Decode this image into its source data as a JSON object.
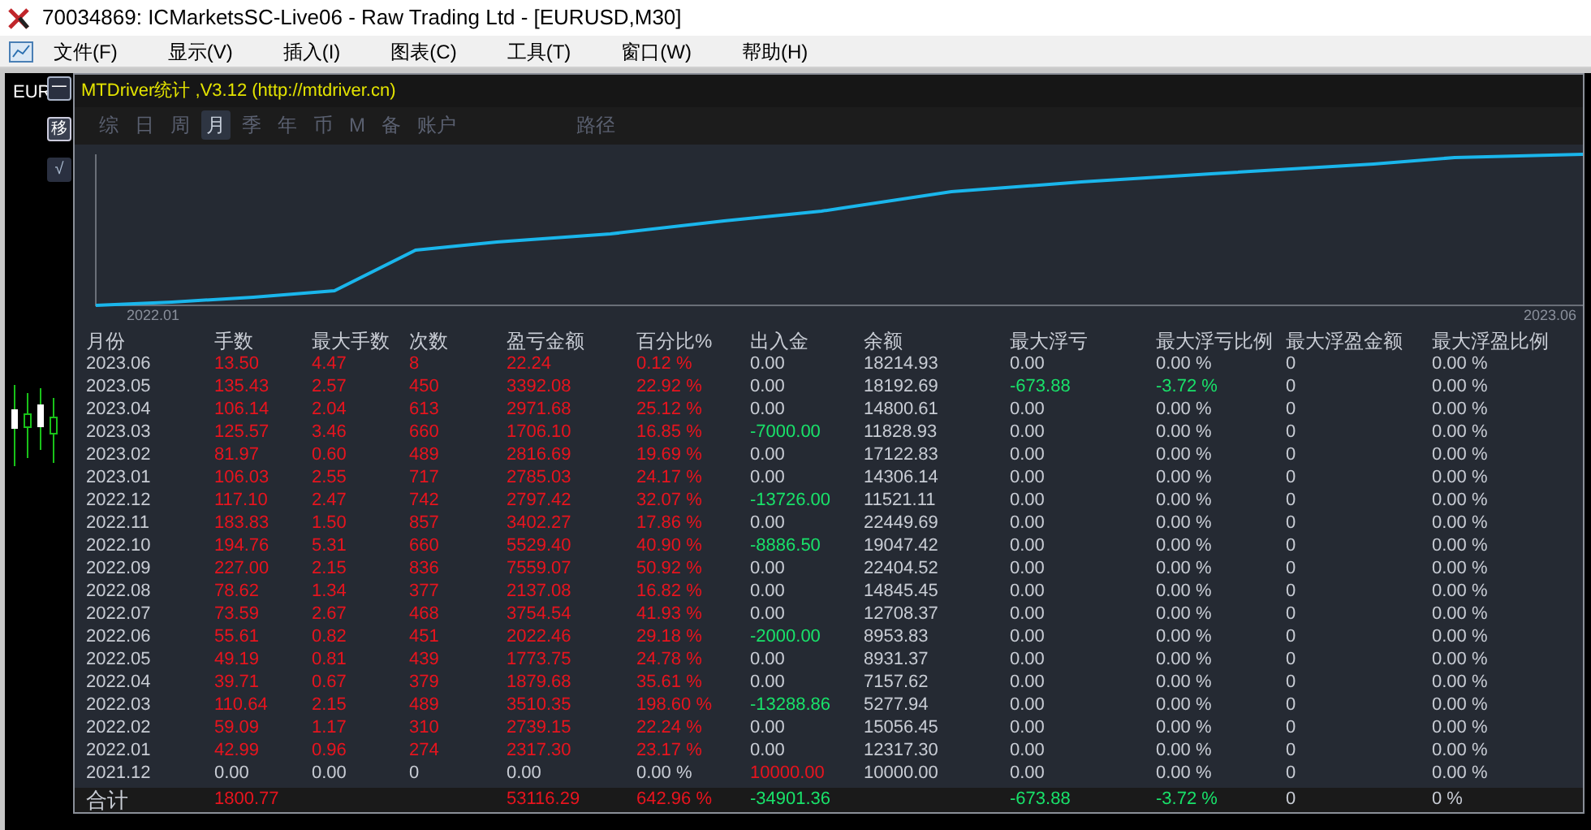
{
  "window": {
    "title": "70034869: ICMarketsSC-Live06 - Raw Trading Ltd - [EURUSD,M30]"
  },
  "menu": [
    "文件(F)",
    "显示(V)",
    "插入(I)",
    "图表(C)",
    "工具(T)",
    "窗口(W)",
    "帮助(H)"
  ],
  "side": {
    "symbol": "EUR",
    "buttons": [
      "一",
      "移",
      "√"
    ]
  },
  "panel": {
    "title": "MTDriver统计 ,V3.12 (http://mtdriver.cn)",
    "tabs": [
      {
        "label": "综",
        "selected": false
      },
      {
        "label": "日",
        "selected": false
      },
      {
        "label": "周",
        "selected": false
      },
      {
        "label": "月",
        "selected": true
      },
      {
        "label": "季",
        "selected": false
      },
      {
        "label": "年",
        "selected": false
      },
      {
        "label": "币",
        "selected": false
      },
      {
        "label": "M",
        "selected": false
      },
      {
        "label": "备",
        "selected": false
      },
      {
        "label": "账户",
        "selected": false
      }
    ],
    "path_button": "路径",
    "chart": {
      "x_start": "2022.01",
      "x_end": "2023.06"
    },
    "table": {
      "columns": [
        "月份",
        "手数",
        "最大手数",
        "次数",
        "盈亏金额",
        "百分比%",
        "出入金",
        "余额",
        "最大浮亏",
        "最大浮亏比例",
        "最大浮盈金额",
        "最大浮盈比例"
      ],
      "rows": [
        [
          {
            "text": "2023.06",
            "color": "#c8ccd4"
          },
          {
            "text": "13.50",
            "color": "#e8141e"
          },
          {
            "text": "4.47",
            "color": "#e8141e"
          },
          {
            "text": "8",
            "color": "#e8141e"
          },
          {
            "text": "22.24",
            "color": "#e8141e"
          },
          {
            "text": "0.12 %",
            "color": "#e8141e"
          },
          {
            "text": "0.00",
            "color": "#c8ccd4"
          },
          {
            "text": "18214.93",
            "color": "#c8ccd4"
          },
          {
            "text": "0.00",
            "color": "#c8ccd4"
          },
          {
            "text": "0.00 %",
            "color": "#c8ccd4"
          },
          {
            "text": "0",
            "color": "#c8ccd4"
          },
          {
            "text": "0.00 %",
            "color": "#c8ccd4"
          }
        ],
        [
          {
            "text": "2023.05",
            "color": "#c8ccd4"
          },
          {
            "text": "135.43",
            "color": "#e8141e"
          },
          {
            "text": "2.57",
            "color": "#e8141e"
          },
          {
            "text": "450",
            "color": "#e8141e"
          },
          {
            "text": "3392.08",
            "color": "#e8141e"
          },
          {
            "text": "22.92 %",
            "color": "#e8141e"
          },
          {
            "text": "0.00",
            "color": "#c8ccd4"
          },
          {
            "text": "18192.69",
            "color": "#c8ccd4"
          },
          {
            "text": "-673.88",
            "color": "#19e26a"
          },
          {
            "text": "-3.72 %",
            "color": "#19e26a"
          },
          {
            "text": "0",
            "color": "#c8ccd4"
          },
          {
            "text": "0.00 %",
            "color": "#c8ccd4"
          }
        ],
        [
          {
            "text": "2023.04",
            "color": "#c8ccd4"
          },
          {
            "text": "106.14",
            "color": "#e8141e"
          },
          {
            "text": "2.04",
            "color": "#e8141e"
          },
          {
            "text": "613",
            "color": "#e8141e"
          },
          {
            "text": "2971.68",
            "color": "#e8141e"
          },
          {
            "text": "25.12 %",
            "color": "#e8141e"
          },
          {
            "text": "0.00",
            "color": "#c8ccd4"
          },
          {
            "text": "14800.61",
            "color": "#c8ccd4"
          },
          {
            "text": "0.00",
            "color": "#c8ccd4"
          },
          {
            "text": "0.00 %",
            "color": "#c8ccd4"
          },
          {
            "text": "0",
            "color": "#c8ccd4"
          },
          {
            "text": "0.00 %",
            "color": "#c8ccd4"
          }
        ],
        [
          {
            "text": "2023.03",
            "color": "#c8ccd4"
          },
          {
            "text": "125.57",
            "color": "#e8141e"
          },
          {
            "text": "3.46",
            "color": "#e8141e"
          },
          {
            "text": "660",
            "color": "#e8141e"
          },
          {
            "text": "1706.10",
            "color": "#e8141e"
          },
          {
            "text": "16.85 %",
            "color": "#e8141e"
          },
          {
            "text": "-7000.00",
            "color": "#19e26a"
          },
          {
            "text": "11828.93",
            "color": "#c8ccd4"
          },
          {
            "text": "0.00",
            "color": "#c8ccd4"
          },
          {
            "text": "0.00 %",
            "color": "#c8ccd4"
          },
          {
            "text": "0",
            "color": "#c8ccd4"
          },
          {
            "text": "0.00 %",
            "color": "#c8ccd4"
          }
        ],
        [
          {
            "text": "2023.02",
            "color": "#c8ccd4"
          },
          {
            "text": "81.97",
            "color": "#e8141e"
          },
          {
            "text": "0.60",
            "color": "#e8141e"
          },
          {
            "text": "489",
            "color": "#e8141e"
          },
          {
            "text": "2816.69",
            "color": "#e8141e"
          },
          {
            "text": "19.69 %",
            "color": "#e8141e"
          },
          {
            "text": "0.00",
            "color": "#c8ccd4"
          },
          {
            "text": "17122.83",
            "color": "#c8ccd4"
          },
          {
            "text": "0.00",
            "color": "#c8ccd4"
          },
          {
            "text": "0.00 %",
            "color": "#c8ccd4"
          },
          {
            "text": "0",
            "color": "#c8ccd4"
          },
          {
            "text": "0.00 %",
            "color": "#c8ccd4"
          }
        ],
        [
          {
            "text": "2023.01",
            "color": "#c8ccd4"
          },
          {
            "text": "106.03",
            "color": "#e8141e"
          },
          {
            "text": "2.55",
            "color": "#e8141e"
          },
          {
            "text": "717",
            "color": "#e8141e"
          },
          {
            "text": "2785.03",
            "color": "#e8141e"
          },
          {
            "text": "24.17 %",
            "color": "#e8141e"
          },
          {
            "text": "0.00",
            "color": "#c8ccd4"
          },
          {
            "text": "14306.14",
            "color": "#c8ccd4"
          },
          {
            "text": "0.00",
            "color": "#c8ccd4"
          },
          {
            "text": "0.00 %",
            "color": "#c8ccd4"
          },
          {
            "text": "0",
            "color": "#c8ccd4"
          },
          {
            "text": "0.00 %",
            "color": "#c8ccd4"
          }
        ],
        [
          {
            "text": "2022.12",
            "color": "#c8ccd4"
          },
          {
            "text": "117.10",
            "color": "#e8141e"
          },
          {
            "text": "2.47",
            "color": "#e8141e"
          },
          {
            "text": "742",
            "color": "#e8141e"
          },
          {
            "text": "2797.42",
            "color": "#e8141e"
          },
          {
            "text": "32.07 %",
            "color": "#e8141e"
          },
          {
            "text": "-13726.00",
            "color": "#19e26a"
          },
          {
            "text": "11521.11",
            "color": "#c8ccd4"
          },
          {
            "text": "0.00",
            "color": "#c8ccd4"
          },
          {
            "text": "0.00 %",
            "color": "#c8ccd4"
          },
          {
            "text": "0",
            "color": "#c8ccd4"
          },
          {
            "text": "0.00 %",
            "color": "#c8ccd4"
          }
        ],
        [
          {
            "text": "2022.11",
            "color": "#c8ccd4"
          },
          {
            "text": "183.83",
            "color": "#e8141e"
          },
          {
            "text": "1.50",
            "color": "#e8141e"
          },
          {
            "text": "857",
            "color": "#e8141e"
          },
          {
            "text": "3402.27",
            "color": "#e8141e"
          },
          {
            "text": "17.86 %",
            "color": "#e8141e"
          },
          {
            "text": "0.00",
            "color": "#c8ccd4"
          },
          {
            "text": "22449.69",
            "color": "#c8ccd4"
          },
          {
            "text": "0.00",
            "color": "#c8ccd4"
          },
          {
            "text": "0.00 %",
            "color": "#c8ccd4"
          },
          {
            "text": "0",
            "color": "#c8ccd4"
          },
          {
            "text": "0.00 %",
            "color": "#c8ccd4"
          }
        ],
        [
          {
            "text": "2022.10",
            "color": "#c8ccd4"
          },
          {
            "text": "194.76",
            "color": "#e8141e"
          },
          {
            "text": "5.31",
            "color": "#e8141e"
          },
          {
            "text": "660",
            "color": "#e8141e"
          },
          {
            "text": "5529.40",
            "color": "#e8141e"
          },
          {
            "text": "40.90 %",
            "color": "#e8141e"
          },
          {
            "text": "-8886.50",
            "color": "#19e26a"
          },
          {
            "text": "19047.42",
            "color": "#c8ccd4"
          },
          {
            "text": "0.00",
            "color": "#c8ccd4"
          },
          {
            "text": "0.00 %",
            "color": "#c8ccd4"
          },
          {
            "text": "0",
            "color": "#c8ccd4"
          },
          {
            "text": "0.00 %",
            "color": "#c8ccd4"
          }
        ],
        [
          {
            "text": "2022.09",
            "color": "#c8ccd4"
          },
          {
            "text": "227.00",
            "color": "#e8141e"
          },
          {
            "text": "2.15",
            "color": "#e8141e"
          },
          {
            "text": "836",
            "color": "#e8141e"
          },
          {
            "text": "7559.07",
            "color": "#e8141e"
          },
          {
            "text": "50.92 %",
            "color": "#e8141e"
          },
          {
            "text": "0.00",
            "color": "#c8ccd4"
          },
          {
            "text": "22404.52",
            "color": "#c8ccd4"
          },
          {
            "text": "0.00",
            "color": "#c8ccd4"
          },
          {
            "text": "0.00 %",
            "color": "#c8ccd4"
          },
          {
            "text": "0",
            "color": "#c8ccd4"
          },
          {
            "text": "0.00 %",
            "color": "#c8ccd4"
          }
        ],
        [
          {
            "text": "2022.08",
            "color": "#c8ccd4"
          },
          {
            "text": "78.62",
            "color": "#e8141e"
          },
          {
            "text": "1.34",
            "color": "#e8141e"
          },
          {
            "text": "377",
            "color": "#e8141e"
          },
          {
            "text": "2137.08",
            "color": "#e8141e"
          },
          {
            "text": "16.82 %",
            "color": "#e8141e"
          },
          {
            "text": "0.00",
            "color": "#c8ccd4"
          },
          {
            "text": "14845.45",
            "color": "#c8ccd4"
          },
          {
            "text": "0.00",
            "color": "#c8ccd4"
          },
          {
            "text": "0.00 %",
            "color": "#c8ccd4"
          },
          {
            "text": "0",
            "color": "#c8ccd4"
          },
          {
            "text": "0.00 %",
            "color": "#c8ccd4"
          }
        ],
        [
          {
            "text": "2022.07",
            "color": "#c8ccd4"
          },
          {
            "text": "73.59",
            "color": "#e8141e"
          },
          {
            "text": "2.67",
            "color": "#e8141e"
          },
          {
            "text": "468",
            "color": "#e8141e"
          },
          {
            "text": "3754.54",
            "color": "#e8141e"
          },
          {
            "text": "41.93 %",
            "color": "#e8141e"
          },
          {
            "text": "0.00",
            "color": "#c8ccd4"
          },
          {
            "text": "12708.37",
            "color": "#c8ccd4"
          },
          {
            "text": "0.00",
            "color": "#c8ccd4"
          },
          {
            "text": "0.00 %",
            "color": "#c8ccd4"
          },
          {
            "text": "0",
            "color": "#c8ccd4"
          },
          {
            "text": "0.00 %",
            "color": "#c8ccd4"
          }
        ],
        [
          {
            "text": "2022.06",
            "color": "#c8ccd4"
          },
          {
            "text": "55.61",
            "color": "#e8141e"
          },
          {
            "text": "0.82",
            "color": "#e8141e"
          },
          {
            "text": "451",
            "color": "#e8141e"
          },
          {
            "text": "2022.46",
            "color": "#e8141e"
          },
          {
            "text": "29.18 %",
            "color": "#e8141e"
          },
          {
            "text": "-2000.00",
            "color": "#19e26a"
          },
          {
            "text": "8953.83",
            "color": "#c8ccd4"
          },
          {
            "text": "0.00",
            "color": "#c8ccd4"
          },
          {
            "text": "0.00 %",
            "color": "#c8ccd4"
          },
          {
            "text": "0",
            "color": "#c8ccd4"
          },
          {
            "text": "0.00 %",
            "color": "#c8ccd4"
          }
        ],
        [
          {
            "text": "2022.05",
            "color": "#c8ccd4"
          },
          {
            "text": "49.19",
            "color": "#e8141e"
          },
          {
            "text": "0.81",
            "color": "#e8141e"
          },
          {
            "text": "439",
            "color": "#e8141e"
          },
          {
            "text": "1773.75",
            "color": "#e8141e"
          },
          {
            "text": "24.78 %",
            "color": "#e8141e"
          },
          {
            "text": "0.00",
            "color": "#c8ccd4"
          },
          {
            "text": "8931.37",
            "color": "#c8ccd4"
          },
          {
            "text": "0.00",
            "color": "#c8ccd4"
          },
          {
            "text": "0.00 %",
            "color": "#c8ccd4"
          },
          {
            "text": "0",
            "color": "#c8ccd4"
          },
          {
            "text": "0.00 %",
            "color": "#c8ccd4"
          }
        ],
        [
          {
            "text": "2022.04",
            "color": "#c8ccd4"
          },
          {
            "text": "39.71",
            "color": "#e8141e"
          },
          {
            "text": "0.67",
            "color": "#e8141e"
          },
          {
            "text": "379",
            "color": "#e8141e"
          },
          {
            "text": "1879.68",
            "color": "#e8141e"
          },
          {
            "text": "35.61 %",
            "color": "#e8141e"
          },
          {
            "text": "0.00",
            "color": "#c8ccd4"
          },
          {
            "text": "7157.62",
            "color": "#c8ccd4"
          },
          {
            "text": "0.00",
            "color": "#c8ccd4"
          },
          {
            "text": "0.00 %",
            "color": "#c8ccd4"
          },
          {
            "text": "0",
            "color": "#c8ccd4"
          },
          {
            "text": "0.00 %",
            "color": "#c8ccd4"
          }
        ],
        [
          {
            "text": "2022.03",
            "color": "#c8ccd4"
          },
          {
            "text": "110.64",
            "color": "#e8141e"
          },
          {
            "text": "2.15",
            "color": "#e8141e"
          },
          {
            "text": "489",
            "color": "#e8141e"
          },
          {
            "text": "3510.35",
            "color": "#e8141e"
          },
          {
            "text": "198.60 %",
            "color": "#e8141e"
          },
          {
            "text": "-13288.86",
            "color": "#19e26a"
          },
          {
            "text": "5277.94",
            "color": "#c8ccd4"
          },
          {
            "text": "0.00",
            "color": "#c8ccd4"
          },
          {
            "text": "0.00 %",
            "color": "#c8ccd4"
          },
          {
            "text": "0",
            "color": "#c8ccd4"
          },
          {
            "text": "0.00 %",
            "color": "#c8ccd4"
          }
        ],
        [
          {
            "text": "2022.02",
            "color": "#c8ccd4"
          },
          {
            "text": "59.09",
            "color": "#e8141e"
          },
          {
            "text": "1.17",
            "color": "#e8141e"
          },
          {
            "text": "310",
            "color": "#e8141e"
          },
          {
            "text": "2739.15",
            "color": "#e8141e"
          },
          {
            "text": "22.24 %",
            "color": "#e8141e"
          },
          {
            "text": "0.00",
            "color": "#c8ccd4"
          },
          {
            "text": "15056.45",
            "color": "#c8ccd4"
          },
          {
            "text": "0.00",
            "color": "#c8ccd4"
          },
          {
            "text": "0.00 %",
            "color": "#c8ccd4"
          },
          {
            "text": "0",
            "color": "#c8ccd4"
          },
          {
            "text": "0.00 %",
            "color": "#c8ccd4"
          }
        ],
        [
          {
            "text": "2022.01",
            "color": "#c8ccd4"
          },
          {
            "text": "42.99",
            "color": "#e8141e"
          },
          {
            "text": "0.96",
            "color": "#e8141e"
          },
          {
            "text": "274",
            "color": "#e8141e"
          },
          {
            "text": "2317.30",
            "color": "#e8141e"
          },
          {
            "text": "23.17 %",
            "color": "#e8141e"
          },
          {
            "text": "0.00",
            "color": "#c8ccd4"
          },
          {
            "text": "12317.30",
            "color": "#c8ccd4"
          },
          {
            "text": "0.00",
            "color": "#c8ccd4"
          },
          {
            "text": "0.00 %",
            "color": "#c8ccd4"
          },
          {
            "text": "0",
            "color": "#c8ccd4"
          },
          {
            "text": "0.00 %",
            "color": "#c8ccd4"
          }
        ],
        [
          {
            "text": "2021.12",
            "color": "#c8ccd4"
          },
          {
            "text": "0.00",
            "color": "#c8ccd4"
          },
          {
            "text": "0.00",
            "color": "#c8ccd4"
          },
          {
            "text": "0",
            "color": "#c8ccd4"
          },
          {
            "text": "0.00",
            "color": "#c8ccd4"
          },
          {
            "text": "0.00 %",
            "color": "#c8ccd4"
          },
          {
            "text": "10000.00",
            "color": "#e8141e"
          },
          {
            "text": "10000.00",
            "color": "#c8ccd4"
          },
          {
            "text": "0.00",
            "color": "#c8ccd4"
          },
          {
            "text": "0.00 %",
            "color": "#c8ccd4"
          },
          {
            "text": "0",
            "color": "#c8ccd4"
          },
          {
            "text": "0.00 %",
            "color": "#c8ccd4"
          }
        ]
      ],
      "total": {
        "label": {
          "text": "合计",
          "color": "#c8ccd4"
        },
        "lots": {
          "text": "1800.77",
          "color": "#e8141e"
        },
        "profit": {
          "text": "53116.29",
          "color": "#e8141e"
        },
        "percent": {
          "text": "642.96 %",
          "color": "#e8141e"
        },
        "deposit": {
          "text": "-34901.36",
          "color": "#19e26a"
        },
        "max_float_loss": {
          "text": "-673.88",
          "color": "#19e26a"
        },
        "max_float_loss_ratio": {
          "text": "-3.72 %",
          "color": "#19e26a"
        },
        "max_float_profit": {
          "text": "0",
          "color": "#c8ccd4"
        },
        "max_float_profit_ratio": {
          "text": "0 %",
          "color": "#c8ccd4"
        }
      }
    }
  }
}
